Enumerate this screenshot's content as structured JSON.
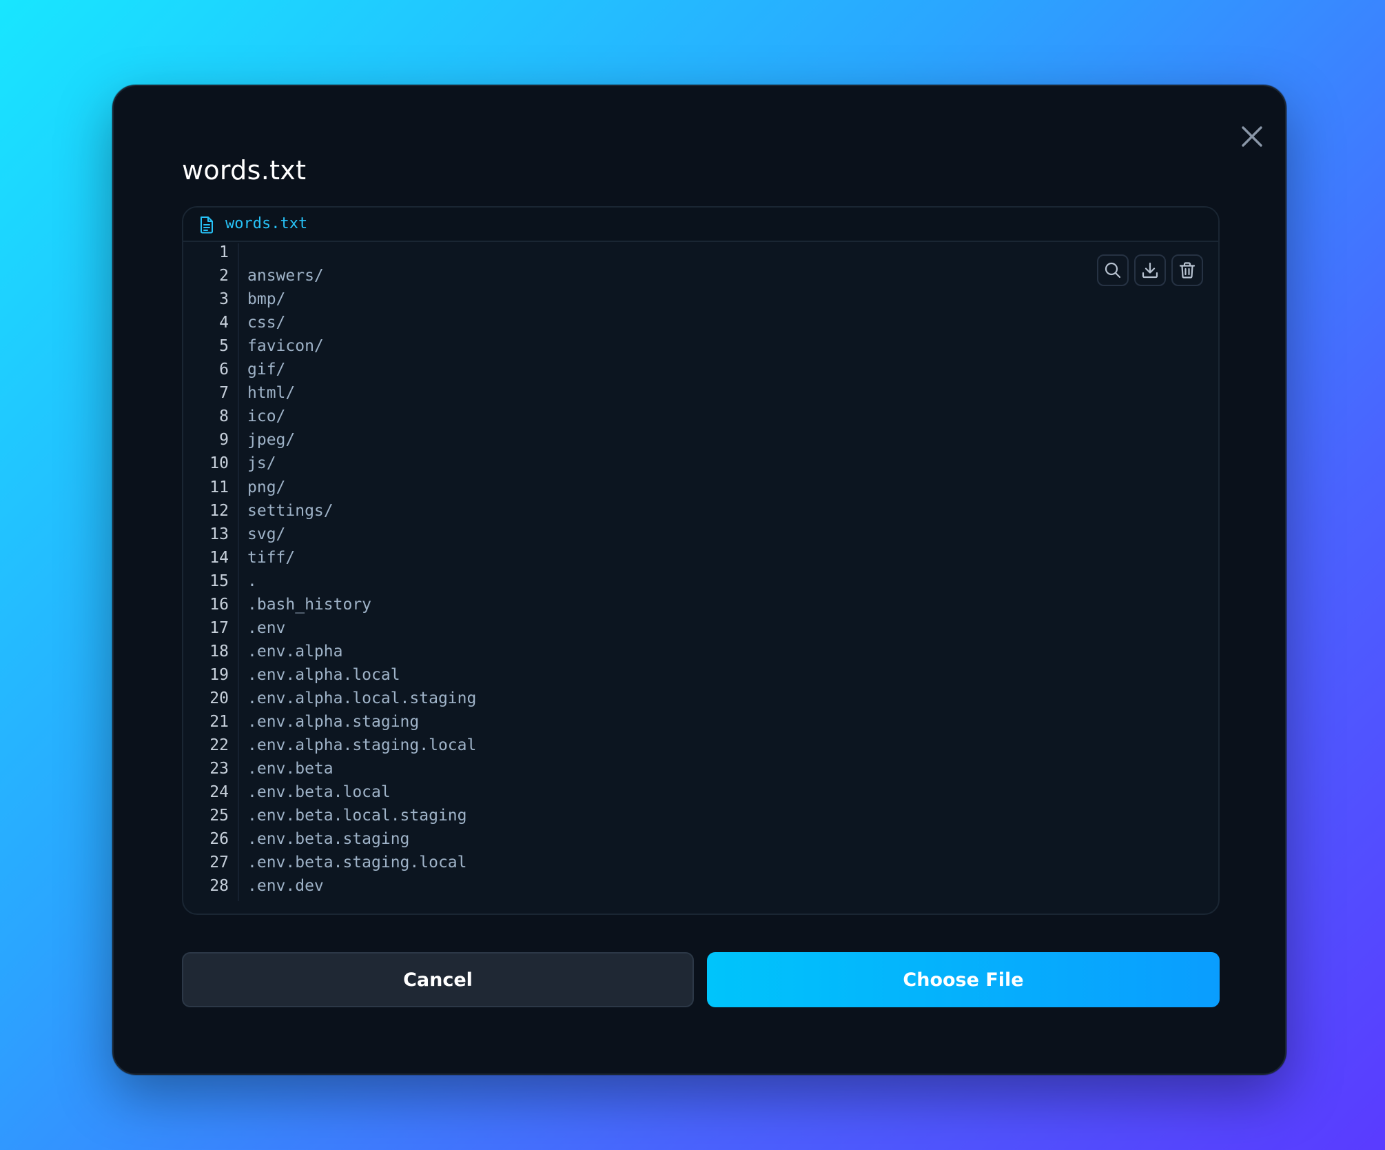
{
  "modal": {
    "title": "words.txt"
  },
  "editor": {
    "file_name": "words.txt",
    "lines": [
      "",
      "answers/",
      "bmp/",
      "css/",
      "favicon/",
      "gif/",
      "html/",
      "ico/",
      "jpeg/",
      "js/",
      "png/",
      "settings/",
      "svg/",
      "tiff/",
      ".",
      ".bash_history",
      ".env",
      ".env.alpha",
      ".env.alpha.local",
      ".env.alpha.local.staging",
      ".env.alpha.staging",
      ".env.alpha.staging.local",
      ".env.beta",
      ".env.beta.local",
      ".env.beta.local.staging",
      ".env.beta.staging",
      ".env.beta.staging.local",
      ".env.dev"
    ],
    "toolbar_icons": [
      "search-icon",
      "download-icon",
      "trash-icon"
    ]
  },
  "actions": {
    "cancel_label": "Cancel",
    "choose_label": "Choose File"
  },
  "colors": {
    "accent": "#0ab4fc",
    "file_name": "#27c2f7",
    "code_text": "#9fb3c8",
    "line_number": "#c7d0db"
  }
}
